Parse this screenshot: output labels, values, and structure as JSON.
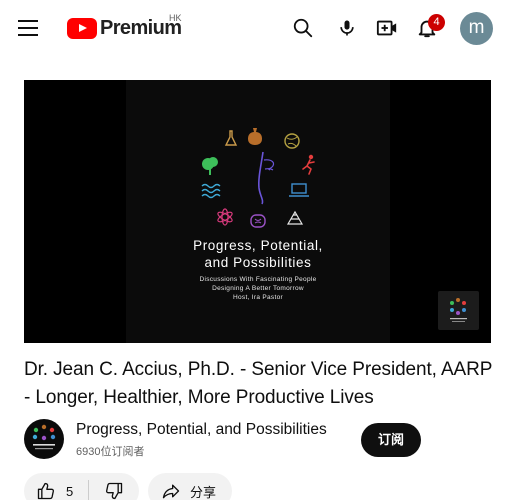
{
  "header": {
    "brand_text": "Premium",
    "region": "HK",
    "notification_count": "4",
    "avatar_letter": "m",
    "icons": [
      "menu-icon",
      "search-icon",
      "mic-icon",
      "create-icon",
      "bell-icon"
    ]
  },
  "video": {
    "thumbnail": {
      "title_line1": "Progress, Potential,",
      "title_line2": "and Possibilities",
      "sub_line1": "Discussions With Fascinating People",
      "sub_line2": "Designing A Better Tomorrow",
      "sub_line3": "Host, Ira Pastor"
    },
    "title": "Dr. Jean C. Accius, Ph.D. - Senior Vice President, AARP - Longer, Healthier, More Productive Lives"
  },
  "channel": {
    "name": "Progress, Potential, and Possibilities",
    "subscribers": "6930位订阅者",
    "subscribe_label": "订阅"
  },
  "actions": {
    "like_count": "5",
    "share_label": "分享"
  },
  "colors": {
    "brand_red": "#ff0000",
    "badge_red": "#cc0000",
    "subscribe_bg": "#0f0f0f",
    "pill_bg": "#f2f2f2"
  }
}
